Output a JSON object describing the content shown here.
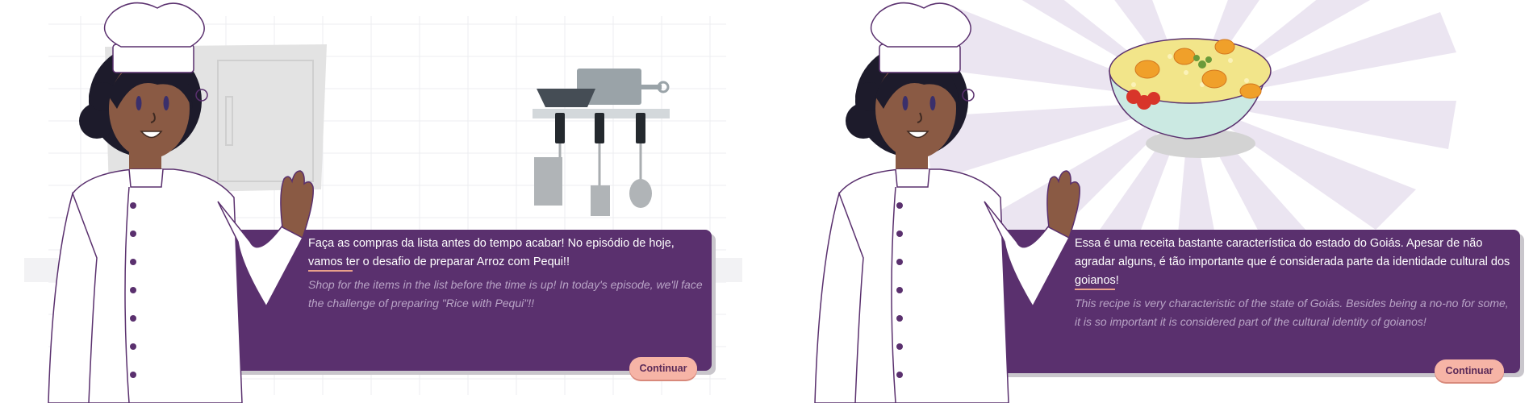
{
  "screens": [
    {
      "dialog_pt": "Faça as compras da lista antes do tempo acabar! No episódio de hoje, vamos ter o desafio de preparar Arroz com Pequi!!",
      "dialog_en": "Shop for the items in the list before the time is up! In today's episode, we'll face the challenge of preparing \"Rice with Pequi\"!!",
      "continue_label": "Continuar"
    },
    {
      "dialog_pt": "Essa é uma receita bastante característica do estado do Goiás. Apesar de não agradar alguns, é tão importante que é considerada parte da identidade cultural dos goianos!",
      "dialog_en": "This recipe is very characteristic of the state of Goiás. Besides being a no-no for some, it is so important it is considered part of the cultural identity of goianos!",
      "continue_label": "Continuar"
    }
  ],
  "colors": {
    "dialog_bg": "#5a306e",
    "button_bg": "#f6b4a6",
    "accent_underline": "#e8a08a"
  }
}
